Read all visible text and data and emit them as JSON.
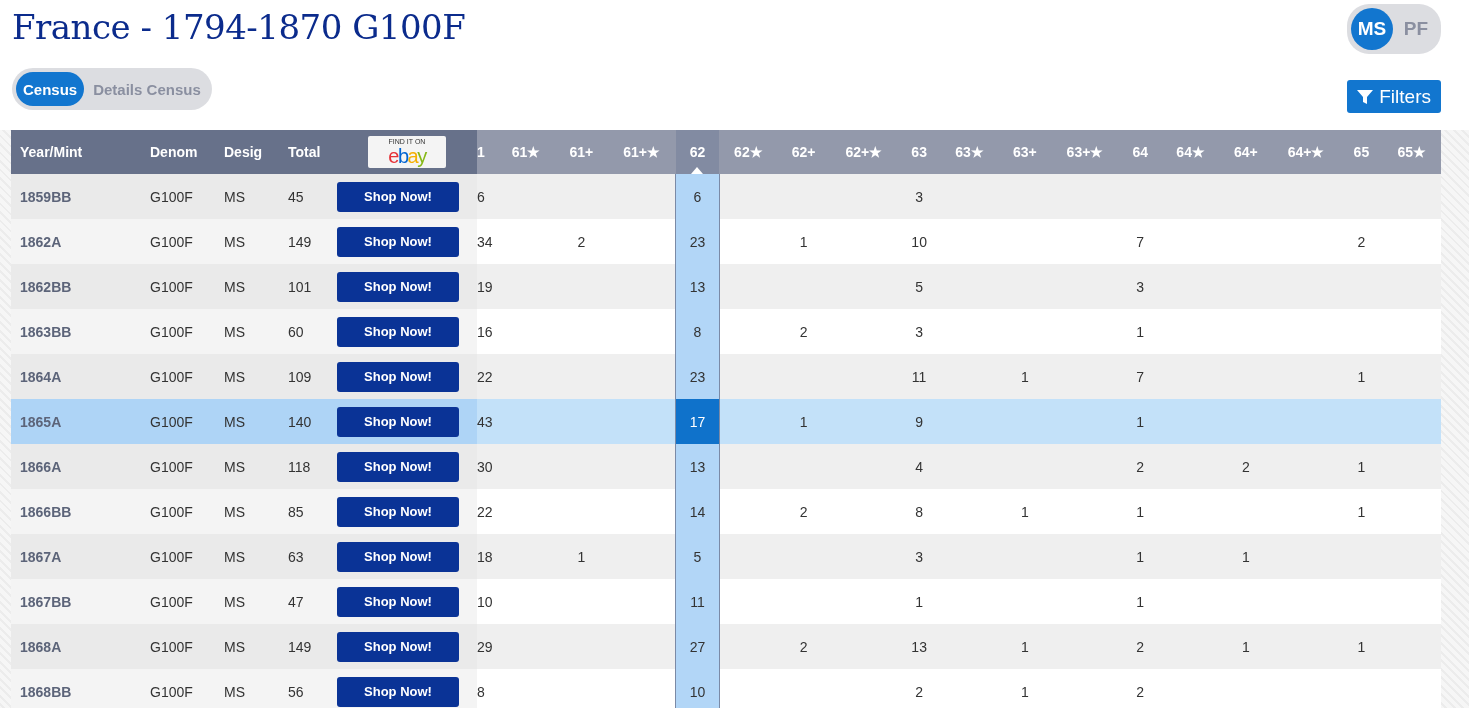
{
  "title": "France - 1794-1870 G100F",
  "view_tabs": [
    {
      "label": "Census",
      "selected": true
    },
    {
      "label": "Details Census",
      "selected": false
    }
  ],
  "grade_type": [
    {
      "label": "MS",
      "selected": true
    },
    {
      "label": "PF",
      "selected": false
    }
  ],
  "filters_button": "Filters",
  "table": {
    "columns": [
      "Year/Mint",
      "Denom",
      "Desig",
      "Total"
    ],
    "ebay_badge": {
      "caption": "FIND IT ON",
      "logo": "ebay"
    },
    "grades": [
      {
        "label": "1",
        "selected": false
      },
      {
        "label": "61★",
        "selected": false
      },
      {
        "label": "61+",
        "selected": false
      },
      {
        "label": "61+★",
        "selected": false
      },
      {
        "label": "62",
        "selected": true
      },
      {
        "label": "62★",
        "selected": false
      },
      {
        "label": "62+",
        "selected": false
      },
      {
        "label": "62+★",
        "selected": false
      },
      {
        "label": "63",
        "selected": false
      },
      {
        "label": "63★",
        "selected": false
      },
      {
        "label": "63+",
        "selected": false
      },
      {
        "label": "63+★",
        "selected": false
      },
      {
        "label": "64",
        "selected": false
      },
      {
        "label": "64★",
        "selected": false
      },
      {
        "label": "64+",
        "selected": false
      },
      {
        "label": "64+★",
        "selected": false
      },
      {
        "label": "65",
        "selected": false
      },
      {
        "label": "65★",
        "selected": false
      }
    ],
    "rows": [
      {
        "year_mint": "1859BB",
        "denom": "G100F",
        "desig": "MS",
        "total": "45",
        "shop": "Shop Now!",
        "selected": false,
        "counts": {
          "col_0": "6",
          "col_4": "6",
          "col_8": "3"
        }
      },
      {
        "year_mint": "1862A",
        "denom": "G100F",
        "desig": "MS",
        "total": "149",
        "shop": "Shop Now!",
        "selected": false,
        "counts": {
          "col_0": "34",
          "col_2": "2",
          "col_4": "23",
          "col_6": "1",
          "col_8": "10",
          "col_12": "7",
          "col_16": "2"
        }
      },
      {
        "year_mint": "1862BB",
        "denom": "G100F",
        "desig": "MS",
        "total": "101",
        "shop": "Shop Now!",
        "selected": false,
        "counts": {
          "col_0": "19",
          "col_4": "13",
          "col_8": "5",
          "col_12": "3"
        }
      },
      {
        "year_mint": "1863BB",
        "denom": "G100F",
        "desig": "MS",
        "total": "60",
        "shop": "Shop Now!",
        "selected": false,
        "counts": {
          "col_0": "16",
          "col_4": "8",
          "col_6": "2",
          "col_8": "3",
          "col_12": "1"
        }
      },
      {
        "year_mint": "1864A",
        "denom": "G100F",
        "desig": "MS",
        "total": "109",
        "shop": "Shop Now!",
        "selected": false,
        "counts": {
          "col_0": "22",
          "col_4": "23",
          "col_8": "11",
          "col_10": "1",
          "col_12": "7",
          "col_16": "1"
        }
      },
      {
        "year_mint": "1865A",
        "denom": "G100F",
        "desig": "MS",
        "total": "140",
        "shop": "Shop Now!",
        "selected": true,
        "counts": {
          "col_0": "43",
          "col_4": "17",
          "col_6": "1",
          "col_8": "9",
          "col_12": "1"
        }
      },
      {
        "year_mint": "1866A",
        "denom": "G100F",
        "desig": "MS",
        "total": "118",
        "shop": "Shop Now!",
        "selected": false,
        "counts": {
          "col_0": "30",
          "col_4": "13",
          "col_8": "4",
          "col_12": "2",
          "col_14": "2",
          "col_16": "1"
        }
      },
      {
        "year_mint": "1866BB",
        "denom": "G100F",
        "desig": "MS",
        "total": "85",
        "shop": "Shop Now!",
        "selected": false,
        "counts": {
          "col_0": "22",
          "col_4": "14",
          "col_6": "2",
          "col_8": "8",
          "col_10": "1",
          "col_12": "1",
          "col_16": "1"
        }
      },
      {
        "year_mint": "1867A",
        "denom": "G100F",
        "desig": "MS",
        "total": "63",
        "shop": "Shop Now!",
        "selected": false,
        "counts": {
          "col_0": "18",
          "col_2": "1",
          "col_4": "5",
          "col_8": "3",
          "col_12": "1",
          "col_14": "1"
        }
      },
      {
        "year_mint": "1867BB",
        "denom": "G100F",
        "desig": "MS",
        "total": "47",
        "shop": "Shop Now!",
        "selected": false,
        "counts": {
          "col_0": "10",
          "col_4": "11",
          "col_8": "1",
          "col_12": "1"
        }
      },
      {
        "year_mint": "1868A",
        "denom": "G100F",
        "desig": "MS",
        "total": "149",
        "shop": "Shop Now!",
        "selected": false,
        "counts": {
          "col_0": "29",
          "col_4": "27",
          "col_6": "2",
          "col_8": "13",
          "col_10": "1",
          "col_12": "2",
          "col_14": "1",
          "col_16": "1"
        }
      },
      {
        "year_mint": "1868BB",
        "denom": "G100F",
        "desig": "MS",
        "total": "56",
        "shop": "Shop Now!",
        "selected": false,
        "counts": {
          "col_0": "8",
          "col_4": "10",
          "col_8": "2",
          "col_10": "1",
          "col_12": "2"
        }
      }
    ]
  }
}
